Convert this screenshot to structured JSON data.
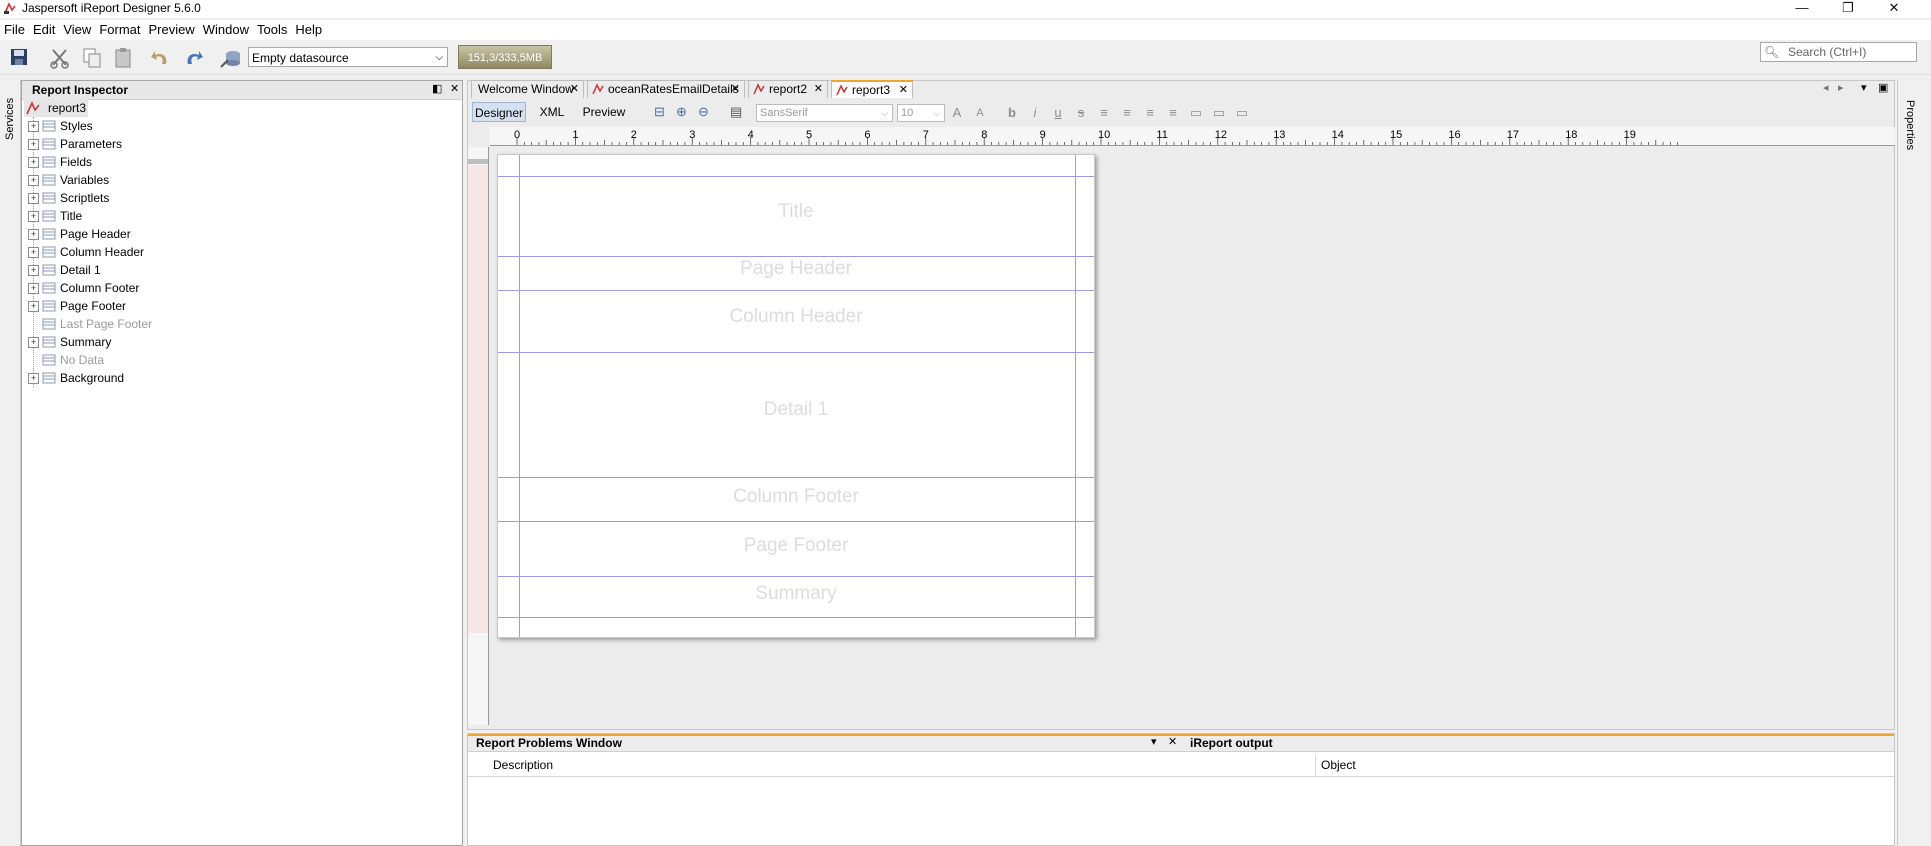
{
  "window": {
    "title": "Jaspersoft iReport Designer 5.6.0",
    "controls": {
      "minimize": "—",
      "restore": "❐",
      "close": "✕"
    }
  },
  "menu": [
    "File",
    "Edit",
    "View",
    "Format",
    "Preview",
    "Window",
    "Tools",
    "Help"
  ],
  "toolbar": {
    "datasource": "Empty datasource",
    "memory": "151,3/333,5MB",
    "search_placeholder": "Search (Ctrl+I)"
  },
  "services_label": "Services",
  "properties_label": "Properties",
  "inspector": {
    "title": "Report Inspector",
    "root": "report3",
    "items": [
      {
        "label": "Styles",
        "icon": "styles-icon",
        "expandable": true,
        "disabled": false
      },
      {
        "label": "Parameters",
        "icon": "parameters-icon",
        "expandable": true,
        "disabled": false
      },
      {
        "label": "Fields",
        "icon": "fields-icon",
        "expandable": true,
        "disabled": false
      },
      {
        "label": "Variables",
        "icon": "variables-icon",
        "expandable": true,
        "disabled": false
      },
      {
        "label": "Scriptlets",
        "icon": "scriptlets-icon",
        "expandable": true,
        "disabled": false
      },
      {
        "label": "Title",
        "icon": "band-icon",
        "expandable": true,
        "disabled": false
      },
      {
        "label": "Page Header",
        "icon": "band-icon",
        "expandable": true,
        "disabled": false
      },
      {
        "label": "Column Header",
        "icon": "band-icon",
        "expandable": true,
        "disabled": false
      },
      {
        "label": "Detail 1",
        "icon": "band-icon",
        "expandable": true,
        "disabled": false
      },
      {
        "label": "Column Footer",
        "icon": "band-icon",
        "expandable": true,
        "disabled": false
      },
      {
        "label": "Page Footer",
        "icon": "band-icon",
        "expandable": true,
        "disabled": false
      },
      {
        "label": "Last Page Footer",
        "icon": "band-icon",
        "expandable": false,
        "disabled": true
      },
      {
        "label": "Summary",
        "icon": "band-icon",
        "expandable": true,
        "disabled": false
      },
      {
        "label": "No Data",
        "icon": "band-icon",
        "expandable": false,
        "disabled": true
      },
      {
        "label": "Background",
        "icon": "band-icon",
        "expandable": true,
        "disabled": false
      }
    ]
  },
  "doc_tabs": [
    {
      "label": "Welcome Window",
      "active": false
    },
    {
      "label": "oceanRatesEmailDetails",
      "active": false
    },
    {
      "label": "report2",
      "active": false
    },
    {
      "label": "report3",
      "active": true
    }
  ],
  "view_tabs": [
    "Designer",
    "XML",
    "Preview"
  ],
  "format_bar": {
    "font": "SansSerif",
    "size": "10"
  },
  "ruler_h": [
    "0",
    "1",
    "2",
    "3",
    "4",
    "5",
    "6",
    "7",
    "8",
    "9",
    "10",
    "11",
    "12",
    "13",
    "14",
    "15",
    "16",
    "17",
    "18",
    "19"
  ],
  "bands": [
    "Title",
    "Page Header",
    "Column Header",
    "Detail 1",
    "Column Footer",
    "Page Footer",
    "Summary"
  ],
  "problems": {
    "title": "Report Problems Window",
    "other_tab": "iReport output",
    "columns": [
      "Description",
      "Object"
    ]
  }
}
